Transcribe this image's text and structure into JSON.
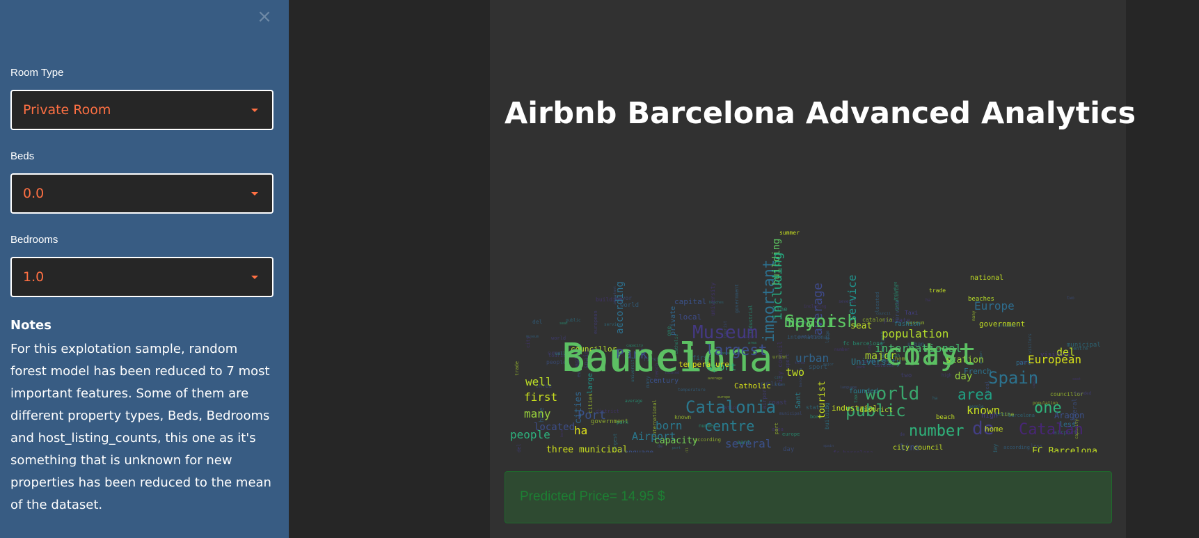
{
  "sidebar": {
    "close_icon": "close-icon",
    "fields": [
      {
        "label": "Room Type",
        "value": "Private Room"
      },
      {
        "label": "Beds",
        "value": "0.0"
      },
      {
        "label": "Bedrooms",
        "value": "1.0"
      }
    ],
    "notes": {
      "title": "Notes",
      "lines": [
        "For this explotation sample, random",
        "forest model has been reduced to 7 most",
        "important features. Some of them are",
        "different property types, Beds, Bedrooms",
        "and host_listing_counts, this one as it's",
        "something that is unknown for new",
        "properties has been reduced to the mean",
        "of the dataset."
      ]
    }
  },
  "main": {
    "title": "Airbnb Barcelona Advanced Analytics",
    "wordcloud": {
      "words": [
        "Barcelona",
        "city",
        "Spanish",
        "Catalonia",
        "Museum",
        "world",
        "Spain",
        "public",
        "largest",
        "number",
        "population",
        "international",
        "Catalan",
        "European",
        "people",
        "centre",
        "area",
        "one",
        "known",
        "Airport",
        "several",
        "first",
        "Port",
        "Park",
        "Europe",
        "government",
        "del",
        "de",
        "important",
        "building",
        "including",
        "well",
        "many",
        "located",
        "three",
        "municipal",
        "ha",
        "born",
        "capacity",
        "urban",
        "major",
        "two",
        "day",
        "station",
        "FC Barcelona",
        "line",
        "home",
        "sport",
        "tourist",
        "service",
        "University",
        "seat",
        "average",
        "according",
        "private",
        "capital",
        "national",
        "beaches",
        "city council",
        "industrial",
        "cities",
        "large",
        "high",
        "less",
        "Aragon",
        "district",
        "Catholic",
        "councillor",
        "temperature",
        "founded",
        "language",
        "beach",
        "century",
        "Sant",
        "part",
        "visitors",
        "summer",
        "local",
        "fashion",
        "French",
        "Taxi",
        "trade",
        "council",
        "coast",
        "mayor"
      ]
    },
    "prediction": {
      "text": "Predicted Price= 14.95 $"
    }
  },
  "colors": {
    "sidebar_bg": "#385c83",
    "accent": "#ff7043",
    "success_bg": "#2e4a31",
    "success_text": "#1d7f33"
  }
}
